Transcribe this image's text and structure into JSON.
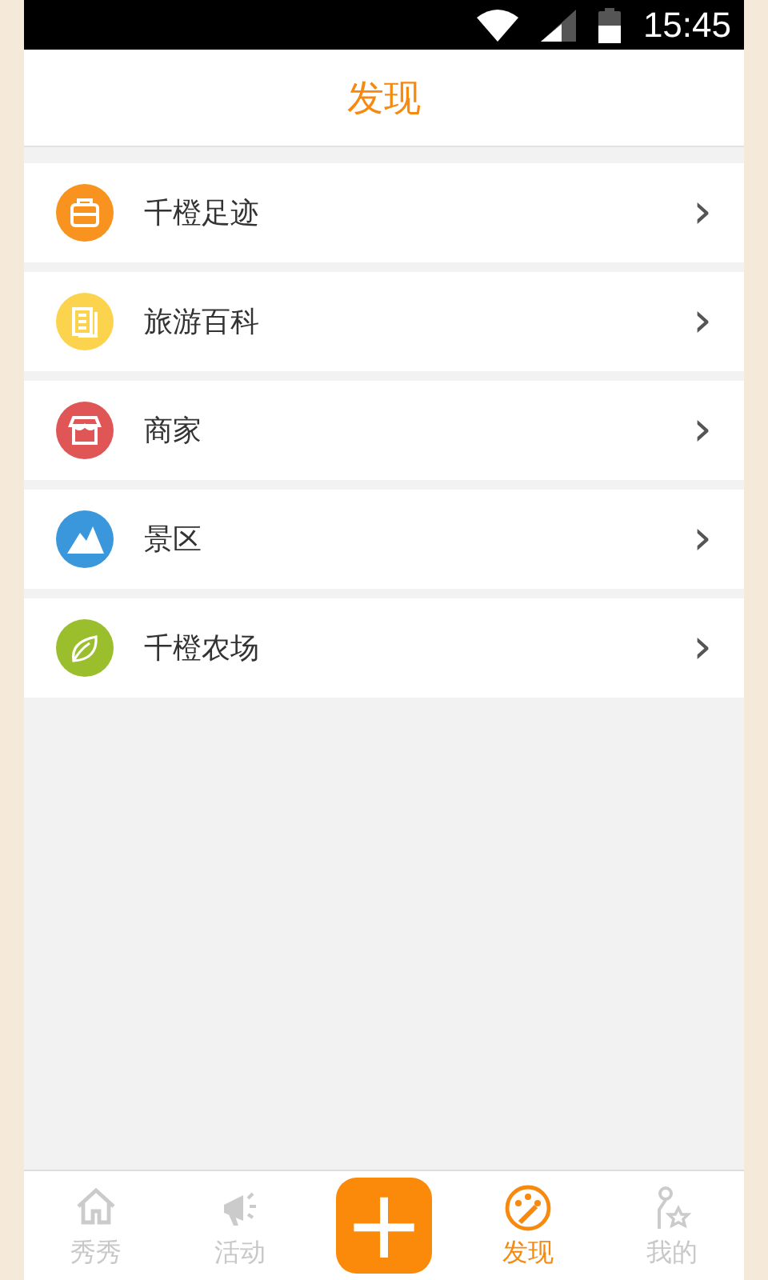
{
  "status_bar": {
    "time": "15:45"
  },
  "header": {
    "title": "发现"
  },
  "items": [
    {
      "label": "千橙足迹",
      "kind": "luggage",
      "color": "#f7931e",
      "chevron": "›"
    },
    {
      "label": "旅游百科",
      "kind": "pages",
      "color": "#fcd34d",
      "chevron": "›"
    },
    {
      "label": "商家",
      "kind": "shop",
      "color": "#e05656",
      "chevron": "›"
    },
    {
      "label": "景区",
      "kind": "mountain",
      "color": "#3b97dc",
      "chevron": "›"
    },
    {
      "label": "千橙农场",
      "kind": "leaf",
      "color": "#9bbf2c",
      "chevron": "›"
    }
  ],
  "tabs": [
    {
      "label": "秀秀",
      "kind": "home",
      "selected": false
    },
    {
      "label": "活动",
      "kind": "megaphone",
      "selected": false
    },
    {
      "kind": "add",
      "plus": "+"
    },
    {
      "label": "发现",
      "kind": "wand",
      "selected": true
    },
    {
      "label": "我的",
      "kind": "person",
      "selected": false
    }
  ]
}
